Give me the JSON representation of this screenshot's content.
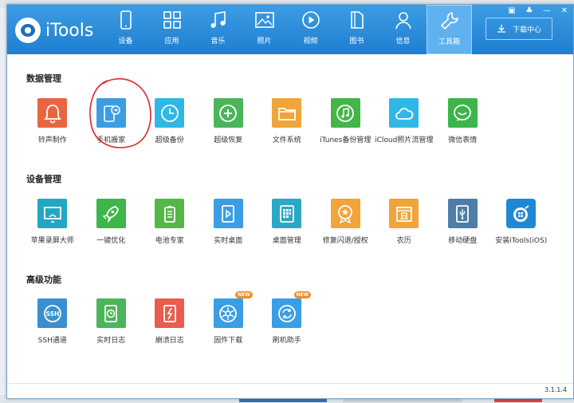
{
  "app": {
    "name": "iTools",
    "version": "3.1.1.4"
  },
  "nav": [
    {
      "label": "设备",
      "icon": "phone-icon"
    },
    {
      "label": "应用",
      "icon": "apps-icon"
    },
    {
      "label": "音乐",
      "icon": "music-icon"
    },
    {
      "label": "照片",
      "icon": "photo-icon"
    },
    {
      "label": "视频",
      "icon": "video-icon"
    },
    {
      "label": "图书",
      "icon": "book-icon"
    },
    {
      "label": "信息",
      "icon": "user-icon"
    },
    {
      "label": "工具箱",
      "icon": "wrench-icon",
      "active": true
    }
  ],
  "download_center": "下载中心",
  "sections": [
    {
      "title": "数据管理",
      "tools": [
        {
          "label": "铃声制作",
          "color": "#e8663f",
          "icon": "bell-icon"
        },
        {
          "label": "手机搬家",
          "color": "#3a9ee4",
          "icon": "phone-transfer-icon"
        },
        {
          "label": "超级备份",
          "color": "#2fb7e6",
          "icon": "clock-icon"
        },
        {
          "label": "超级恢复",
          "color": "#4bb55a",
          "icon": "plus-circle-icon"
        },
        {
          "label": "文件系统",
          "color": "#f0a43a",
          "icon": "folder-icon"
        },
        {
          "label": "iTunes备份管理",
          "color": "#43b549",
          "icon": "music-circle-icon"
        },
        {
          "label": "iCloud照片流管理",
          "color": "#2fb8e6",
          "icon": "cloud-icon"
        },
        {
          "label": "微信表情",
          "color": "#3cb54a",
          "icon": "smile-icon"
        }
      ]
    },
    {
      "title": "设备管理",
      "tools": [
        {
          "label": "苹果录屏大师",
          "color": "#22a7c2",
          "icon": "screen-icon"
        },
        {
          "label": "一键优化",
          "color": "#3db549",
          "icon": "rocket-icon"
        },
        {
          "label": "电池专家",
          "color": "#55b747",
          "icon": "battery-icon"
        },
        {
          "label": "实时桌面",
          "color": "#3a9ee4",
          "icon": "play-screen-icon"
        },
        {
          "label": "桌面管理",
          "color": "#2aa8c6",
          "icon": "grid-icon"
        },
        {
          "label": "修复闪退/授权",
          "color": "#f0a43a",
          "icon": "badge-icon"
        },
        {
          "label": "农历",
          "color": "#f0a43a",
          "icon": "calendar-icon"
        },
        {
          "label": "移动硬盘",
          "color": "#4d7ea8",
          "icon": "usb-icon"
        },
        {
          "label": "安装iTools(iOS)",
          "color": "#1f88d6",
          "icon": "itools-logo-icon"
        }
      ]
    },
    {
      "title": "高级功能",
      "tools": [
        {
          "label": "SSH通道",
          "color": "#3a8fcf",
          "icon": "ssh-icon"
        },
        {
          "label": "实时日志",
          "color": "#4bb55a",
          "icon": "log-icon"
        },
        {
          "label": "崩溃日志",
          "color": "#e85d4e",
          "icon": "crash-icon"
        },
        {
          "label": "固件下载",
          "color": "#3a9ee4",
          "icon": "gear-icon",
          "badge": "NEW"
        },
        {
          "label": "刷机助手",
          "color": "#3a9ee4",
          "icon": "refresh-icon",
          "badge": "NEW"
        }
      ]
    }
  ]
}
